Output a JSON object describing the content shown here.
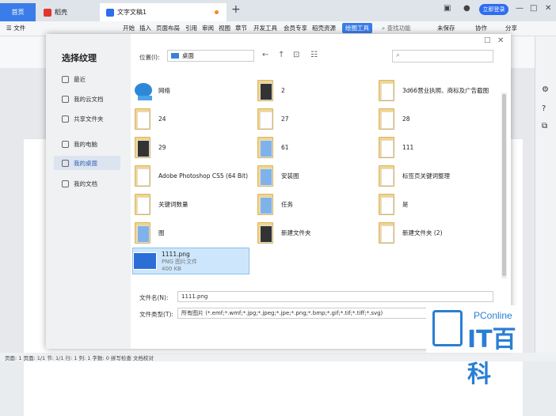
{
  "tabs": {
    "home": "首页",
    "wps": "稻壳",
    "doc": "文字文稿1",
    "plus": "+"
  },
  "titlebar": {
    "login": "立即登录"
  },
  "menubar": {
    "file": "文件",
    "items": [
      "开始",
      "插入",
      "页面布局",
      "引用",
      "审阅",
      "视图",
      "章节",
      "开发工具",
      "会员专享",
      "稻壳资源",
      "绘图工具"
    ],
    "search": "查找功能",
    "unsaved": "未保存",
    "collab": "协作",
    "share": "分享"
  },
  "dialog": {
    "title": "选择纹理",
    "sidebar": [
      "最近",
      "我的云文档",
      "共享文件夹",
      "我的电脑",
      "我的桌面",
      "我的文档"
    ],
    "location_label": "位置(I):",
    "location_value": "桌面",
    "files": [
      {
        "name": "网络",
        "kind": "network"
      },
      {
        "name": "2",
        "kind": "folder-dark"
      },
      {
        "name": "3d66营业执照、商标及广告截图",
        "kind": "folder"
      },
      {
        "name": "24",
        "kind": "folder"
      },
      {
        "name": "27",
        "kind": "folder"
      },
      {
        "name": "28",
        "kind": "folder"
      },
      {
        "name": "29",
        "kind": "folder-dark"
      },
      {
        "name": "61",
        "kind": "folder-blue"
      },
      {
        "name": "111",
        "kind": "folder"
      },
      {
        "name": "Adobe Photoshop CS5 (64 Bit)",
        "kind": "folder"
      },
      {
        "name": "安装图",
        "kind": "folder-blue"
      },
      {
        "name": "标签页关键词整理",
        "kind": "folder"
      },
      {
        "name": "关键词数量",
        "kind": "folder"
      },
      {
        "name": "任务",
        "kind": "folder-blue"
      },
      {
        "name": "是",
        "kind": "folder"
      },
      {
        "name": "图",
        "kind": "folder-blue"
      },
      {
        "name": "新建文件夹",
        "kind": "folder-dark"
      },
      {
        "name": "新建文件夹 (2)",
        "kind": "folder"
      }
    ],
    "selected_file": {
      "name": "1111.png",
      "type": "PNG 图片文件",
      "size": "400 KB"
    },
    "filename_label": "文件名(N):",
    "filename_value": "1111.png",
    "filetype_label": "文件类型(T):",
    "filetype_value": "所有图片 (*.emf;*.wmf;*.jpg;*.jpeg;*.jpe;*.png;*.bmp;*.gif;*.tif;*.tiff;*.svg)"
  },
  "statusbar": {
    "text": "页面: 1  页面: 1/1  节: 1/1  行: 1  列: 1  字数: 0  拼写检查  文档校对"
  },
  "watermark": {
    "line1": "PConline",
    "line2": "IT百科"
  }
}
